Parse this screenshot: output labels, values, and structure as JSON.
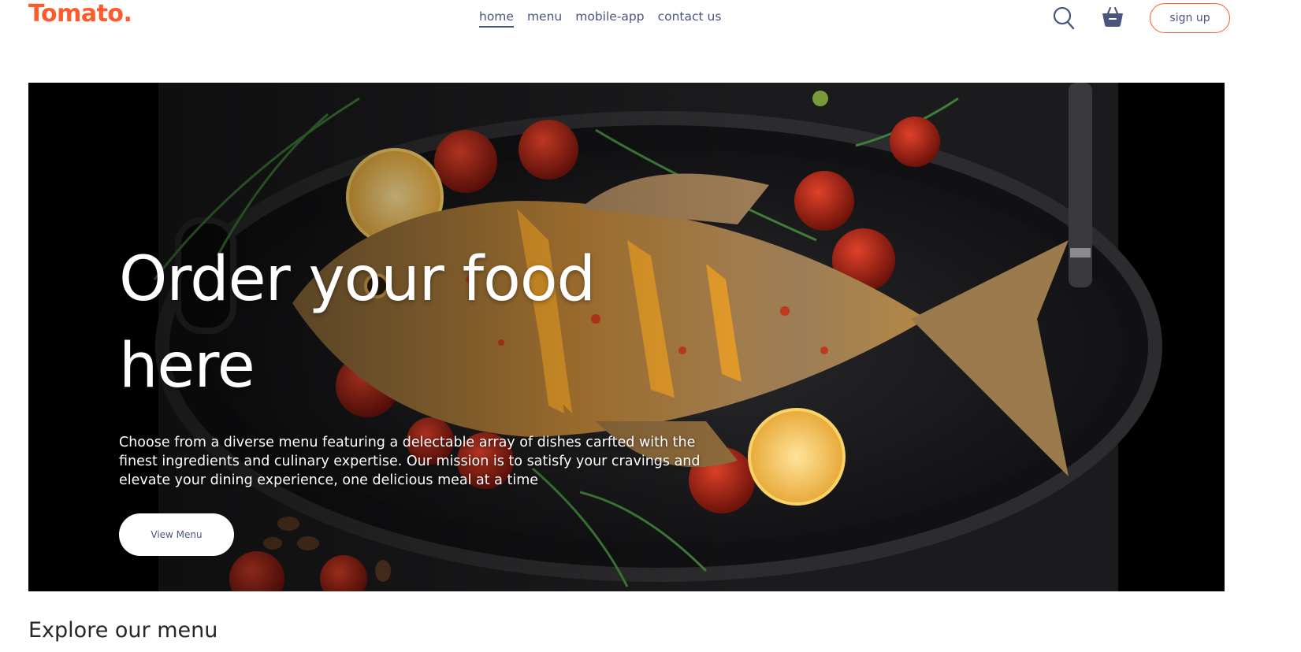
{
  "navbar": {
    "logo": "Tomato.",
    "links": [
      "home",
      "menu",
      "mobile-app",
      "contact us"
    ],
    "active_link": "home",
    "search_icon": "search-icon",
    "basket_icon": "basket-icon",
    "signup_label": "sign up"
  },
  "hero": {
    "title_line1": "Order your food",
    "title_line2": "here",
    "description": "Choose from a diverse menu featuring a delectable array of dishes carfted with the finest ingredients and culinary expertise. Our mission is to satisfy your cravings and elevate your dining experience, one delicious meal at a time",
    "button_label": "View Menu"
  },
  "explore": {
    "title": "Explore our menu"
  },
  "colors": {
    "accent": "#ff5a2c",
    "nav_text": "#49557e",
    "hero_bg": "#000000"
  }
}
